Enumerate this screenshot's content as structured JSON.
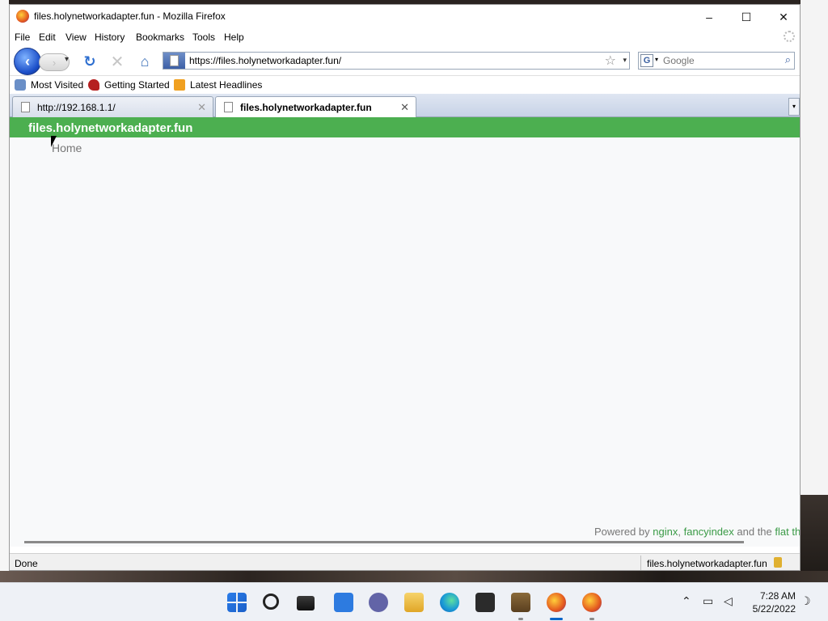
{
  "window": {
    "title": "files.holynetworkadapter.fun - Mozilla Firefox",
    "minimize": "–",
    "maximize": "☐",
    "close": "✕"
  },
  "menu": [
    "File",
    "Edit",
    "View",
    "History",
    "Bookmarks",
    "Tools",
    "Help"
  ],
  "nav": {
    "url": "https://files.holynetworkadapter.fun/",
    "search_placeholder": "Google",
    "search_engine": "G"
  },
  "bookmarks": [
    "Most Visited",
    "Getting Started",
    "Latest Headlines"
  ],
  "tabs": [
    {
      "label": "http://192.168.1.1/",
      "active": false
    },
    {
      "label": "files.holynetworkadapter.fun",
      "active": true
    }
  ],
  "page": {
    "site_title": "files.holynetworkadapter.fun",
    "breadcrumb": "Home",
    "footer_prefix": "Powered by",
    "footer_link1": "nginx",
    "footer_sep": ",",
    "footer_link2": "fancyindex",
    "footer_mid": "and the",
    "footer_link3": "flat th",
    "accent_color": "#4caf50",
    "link_color": "#3a9a46"
  },
  "status": {
    "text": "Done",
    "host": "files.holynetworkadapter.fun"
  },
  "taskbar": {
    "apps": [
      "start",
      "search",
      "task-view",
      "widgets",
      "chat",
      "file-explorer",
      "edge",
      "store",
      "minecraft",
      "firefox",
      "firefox"
    ],
    "time": "7:28 AM",
    "date": "5/22/2022"
  }
}
